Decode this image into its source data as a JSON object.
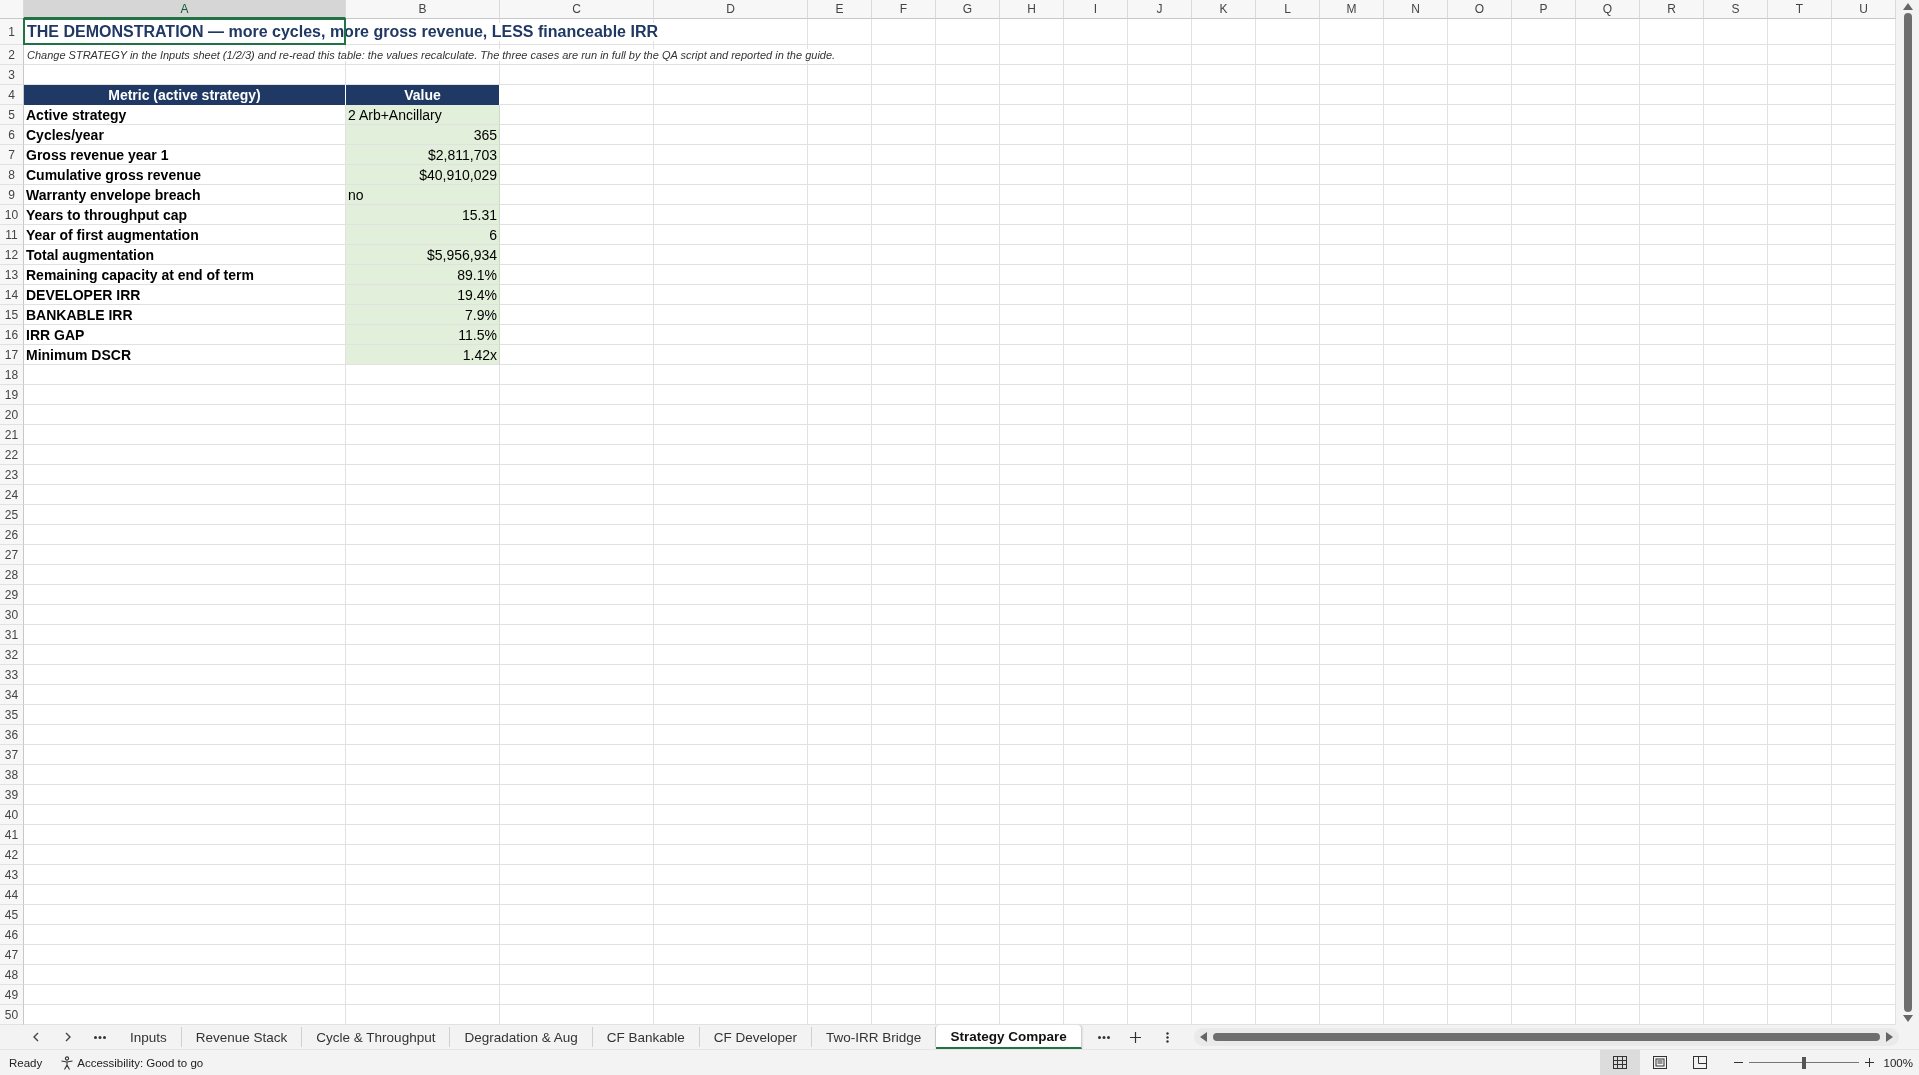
{
  "columns": [
    {
      "label": "A",
      "selected": true
    },
    {
      "label": "B",
      "selected": false
    },
    {
      "label": "C",
      "selected": false
    },
    {
      "label": "D",
      "selected": false
    },
    {
      "label": "E",
      "selected": false
    },
    {
      "label": "F",
      "selected": false
    },
    {
      "label": "G",
      "selected": false
    },
    {
      "label": "H",
      "selected": false
    },
    {
      "label": "I",
      "selected": false
    },
    {
      "label": "J",
      "selected": false
    },
    {
      "label": "K",
      "selected": false
    },
    {
      "label": "L",
      "selected": false
    },
    {
      "label": "M",
      "selected": false
    },
    {
      "label": "N",
      "selected": false
    },
    {
      "label": "O",
      "selected": false
    },
    {
      "label": "P",
      "selected": false
    },
    {
      "label": "Q",
      "selected": false
    },
    {
      "label": "R",
      "selected": false
    },
    {
      "label": "S",
      "selected": false
    },
    {
      "label": "T",
      "selected": false
    },
    {
      "label": "U",
      "selected": false
    }
  ],
  "row_numbers": [
    "1",
    "2",
    "3",
    "4",
    "5",
    "6",
    "7",
    "8",
    "9",
    "10",
    "11",
    "12",
    "13",
    "14",
    "15",
    "16",
    "17",
    "18",
    "19",
    "20",
    "21",
    "22",
    "23",
    "24",
    "25",
    "26",
    "27",
    "28",
    "29",
    "30",
    "31",
    "32",
    "33",
    "34",
    "35",
    "36",
    "37",
    "38",
    "39",
    "40",
    "41",
    "42",
    "43",
    "44",
    "45",
    "46",
    "47",
    "48",
    "49",
    "50"
  ],
  "title": "THE DEMONSTRATION — more cycles, more gross revenue, LESS financeable IRR",
  "note": "Change STRATEGY in the Inputs sheet (1/2/3) and re-read this table: the values recalculate. The three cases are run in full by the QA script and reported in the guide.",
  "table": {
    "columns": [
      "Metric (active strategy)",
      "Value"
    ],
    "rows": [
      {
        "metric": "Active strategy",
        "value": "2 Arb+Ancillary",
        "kind": "text"
      },
      {
        "metric": "Cycles/year",
        "value": "365",
        "kind": "number"
      },
      {
        "metric": "Gross revenue year 1",
        "value": "$2,811,703",
        "kind": "number"
      },
      {
        "metric": "Cumulative gross revenue",
        "value": "$40,910,029",
        "kind": "number"
      },
      {
        "metric": "Warranty envelope breach",
        "value": "no",
        "kind": "text"
      },
      {
        "metric": "Years to throughput cap",
        "value": "15.31",
        "kind": "number"
      },
      {
        "metric": "Year of first augmentation",
        "value": "6",
        "kind": "number"
      },
      {
        "metric": "Total augmentation",
        "value": "$5,956,934",
        "kind": "number"
      },
      {
        "metric": "Remaining capacity at end of term",
        "value": "89.1%",
        "kind": "number"
      },
      {
        "metric": "DEVELOPER IRR",
        "value": "19.4%",
        "kind": "number"
      },
      {
        "metric": "BANKABLE IRR",
        "value": "7.9%",
        "kind": "number"
      },
      {
        "metric": "IRR GAP",
        "value": "11.5%",
        "kind": "number"
      },
      {
        "metric": "Minimum DSCR",
        "value": "1.42x",
        "kind": "number"
      }
    ]
  },
  "sheet_tabs": [
    {
      "label": "Inputs",
      "selected": false
    },
    {
      "label": "Revenue Stack",
      "selected": false
    },
    {
      "label": "Cycle & Throughput",
      "selected": false
    },
    {
      "label": "Degradation & Aug",
      "selected": false
    },
    {
      "label": "CF Bankable",
      "selected": false
    },
    {
      "label": "CF Developer",
      "selected": false
    },
    {
      "label": "Two-IRR Bridge",
      "selected": false
    },
    {
      "label": "Strategy Compare",
      "selected": true
    }
  ],
  "status_bar": {
    "status": "Ready",
    "accessibility": "Accessibility: Good to go",
    "view_buttons": [
      {
        "kind": "normal",
        "selected": true
      },
      {
        "kind": "page-layout",
        "selected": false
      },
      {
        "kind": "page-break",
        "selected": false
      }
    ],
    "zoom_slider": {
      "level": 0.5
    },
    "zoom": "100%"
  }
}
